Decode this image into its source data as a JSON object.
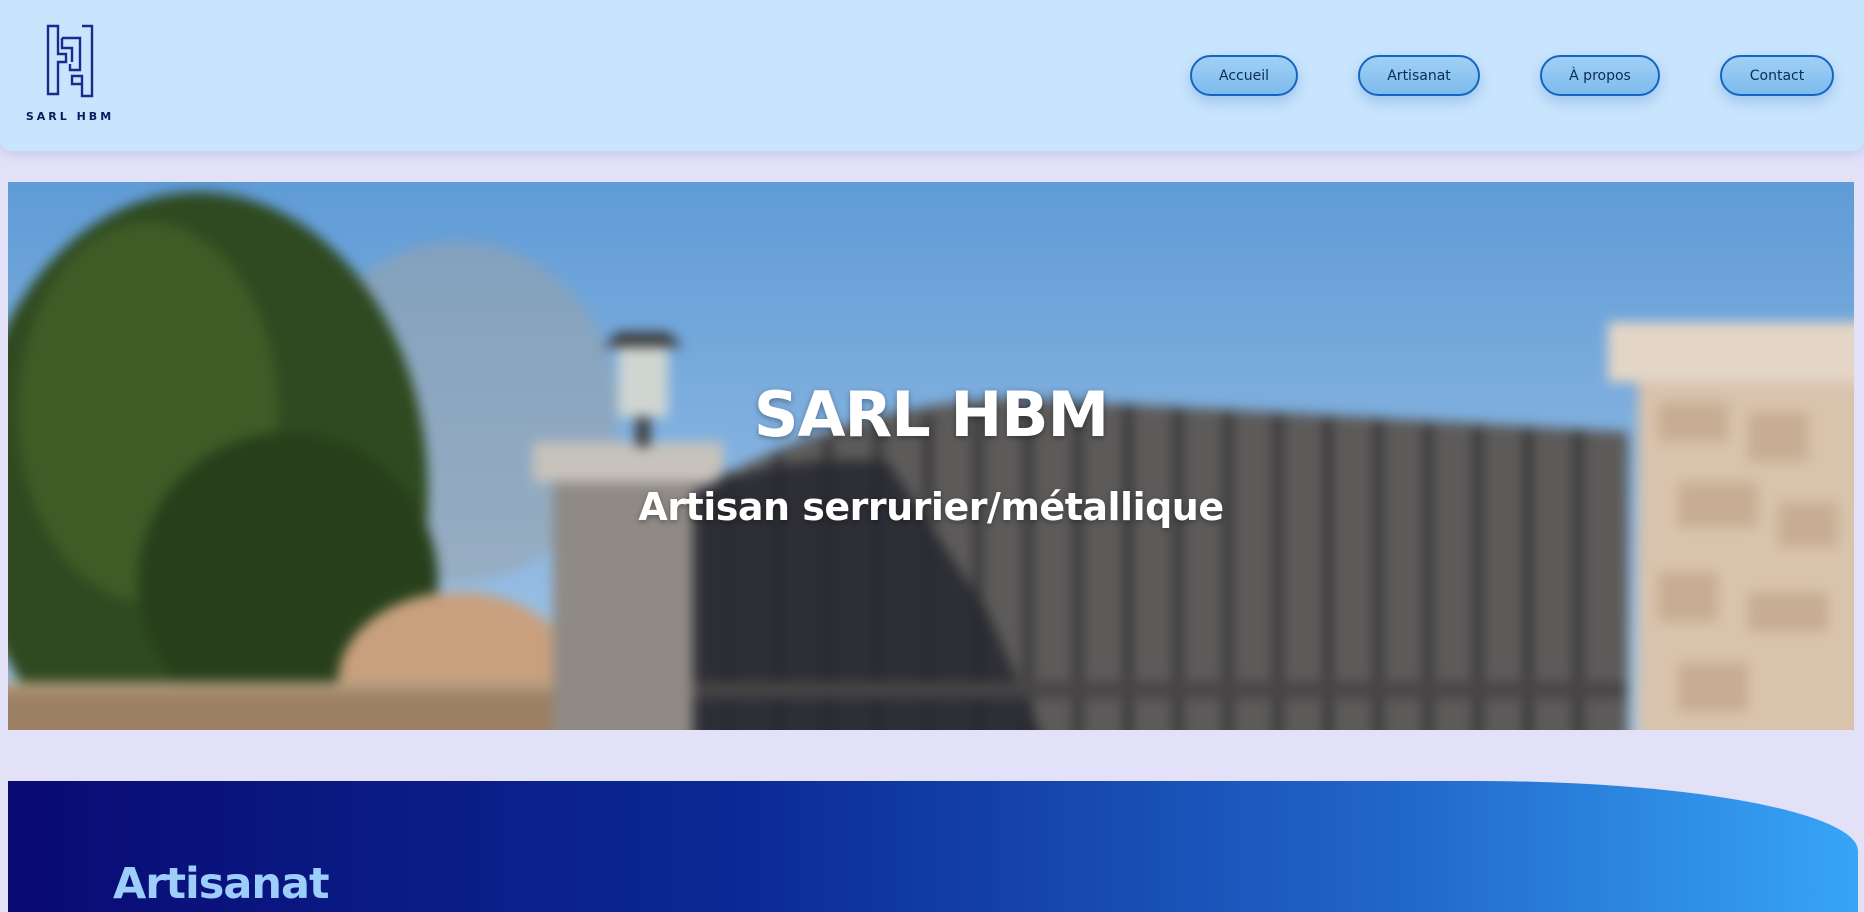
{
  "header": {
    "logo_text": "SARL HBM",
    "logo_icon": "hb-monogram-icon",
    "nav": [
      {
        "label": "Accueil"
      },
      {
        "label": "Artisanat"
      },
      {
        "label": "À propos"
      },
      {
        "label": "Contact"
      }
    ]
  },
  "hero": {
    "title": "SARL HBM",
    "subtitle": "Artisan serrurier/métallique",
    "image": "wrought-iron-gate-photo"
  },
  "section": {
    "title": "Artisanat"
  },
  "colors": {
    "header_bg": "#c9e5fd",
    "page_bg": "#e2e1f8",
    "nav_border": "#1565c0",
    "section_gradient_start": "#0a0a73",
    "section_gradient_end": "#37a6f7",
    "section_title": "#9dcdfb"
  }
}
